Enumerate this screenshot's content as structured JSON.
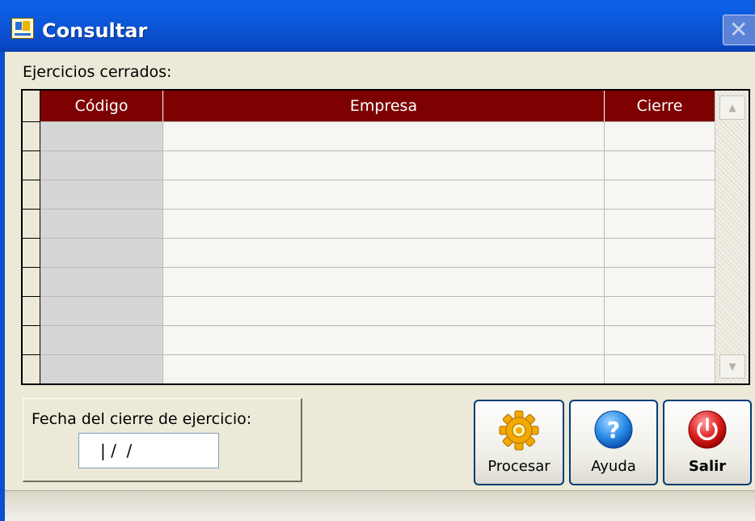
{
  "window": {
    "title": "Consultar",
    "close_symbol": "✕"
  },
  "grid": {
    "label": "Ejercicios cerrados:",
    "columns": [
      "Código",
      "Empresa",
      "Cierre"
    ],
    "row_count": 9,
    "header_color": "#7d0101"
  },
  "fecha": {
    "label": "Fecha del cierre de ejercicio:",
    "value": "| /  /"
  },
  "buttons": {
    "procesar": {
      "label": "Procesar",
      "icon": "gear-icon"
    },
    "ayuda": {
      "label": "Ayuda",
      "icon": "help-icon"
    },
    "salir": {
      "label": "Salir",
      "icon": "power-icon"
    }
  }
}
